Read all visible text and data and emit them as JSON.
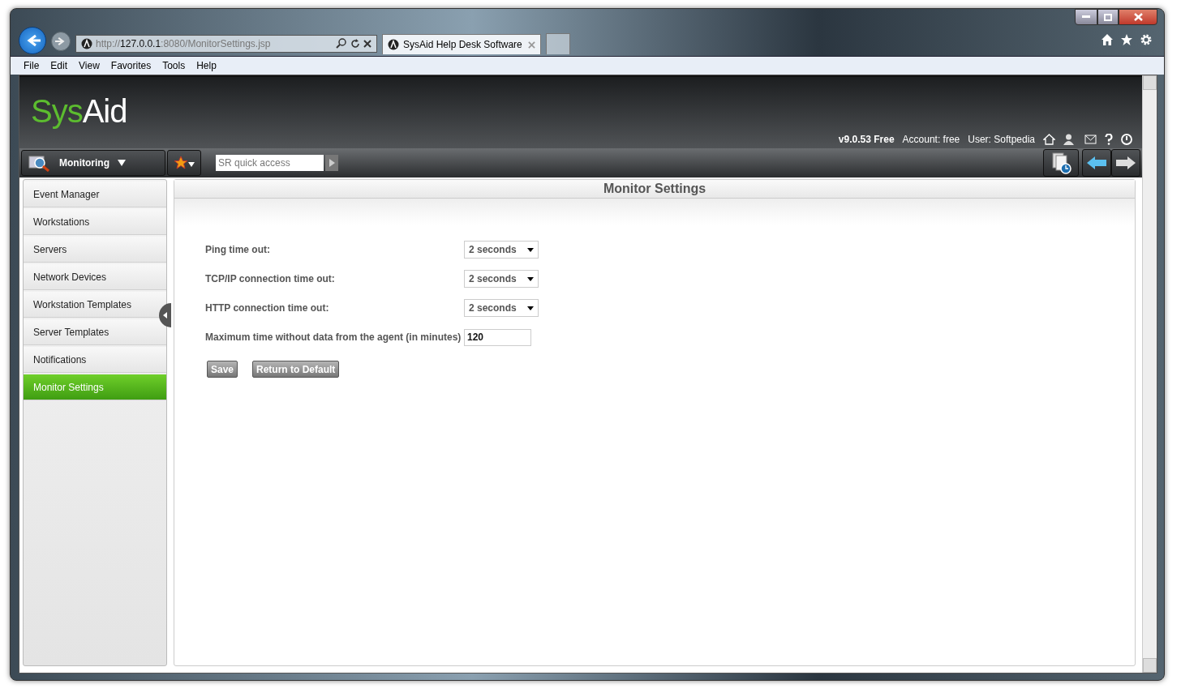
{
  "browser": {
    "address": {
      "prefix": "http://",
      "host": "127.0.0.1",
      "rest": ":8080/MonitorSettings.jsp"
    },
    "tabs": [
      {
        "label": "SysAid Help Desk Software",
        "selected": true
      }
    ],
    "menu": [
      "File",
      "Edit",
      "View",
      "Favorites",
      "Tools",
      "Help"
    ]
  },
  "header": {
    "logo": {
      "part_1": "Sys",
      "part_2": "Aid"
    },
    "version": "v9.0.53 Free",
    "account": "Account: free",
    "user": "User: Softpedia"
  },
  "toolbar": {
    "module": "Monitoring",
    "quick_access": {
      "placeholder": "SR quick access"
    }
  },
  "sidebar": {
    "items": [
      {
        "label": "Event Manager",
        "selected": false
      },
      {
        "label": "Workstations",
        "selected": false
      },
      {
        "label": "Servers",
        "selected": false
      },
      {
        "label": "Network Devices",
        "selected": false
      },
      {
        "label": "Workstation Templates",
        "selected": false
      },
      {
        "label": "Server Templates",
        "selected": false
      },
      {
        "label": "Notifications",
        "selected": false
      },
      {
        "label": "Monitor Settings",
        "selected": true
      }
    ]
  },
  "panel": {
    "title": "Monitor Settings",
    "fields": [
      {
        "kind": "select",
        "label": "Ping time out:",
        "value": "2 seconds"
      },
      {
        "kind": "select",
        "label": "TCP/IP connection time out:",
        "value": "2 seconds"
      },
      {
        "kind": "select",
        "label": "HTTP connection time out:",
        "value": "2 seconds"
      },
      {
        "kind": "input",
        "label": "Maximum time without data from the agent (in minutes)",
        "value": "120"
      }
    ],
    "buttons": [
      "Save",
      "Return to Default"
    ]
  }
}
